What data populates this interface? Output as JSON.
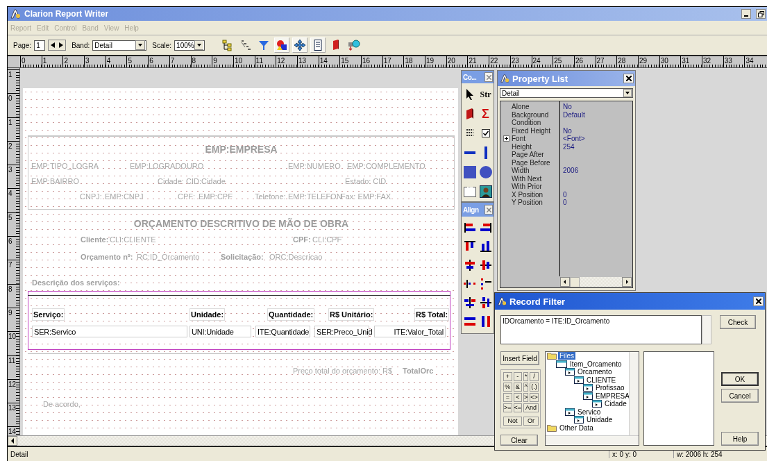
{
  "window": {
    "title": "Clarion Report Writer"
  },
  "menu": [
    {
      "label": "Report",
      "disabled": true
    },
    {
      "label": "Edit",
      "disabled": true
    },
    {
      "label": "Control",
      "disabled": true
    },
    {
      "label": "Band",
      "disabled": true
    },
    {
      "label": "View",
      "disabled": true
    },
    {
      "label": "Help",
      "disabled": true
    }
  ],
  "toolbar": {
    "page_label": "Page:",
    "page": "1",
    "band_label": "Band:",
    "band": "Detail",
    "scale_label": "Scale:",
    "scale": "100%",
    "buttons": [
      {
        "kind": "tree",
        "pressed": false
      },
      {
        "kind": "sort",
        "pressed": false
      },
      {
        "kind": "filter",
        "pressed": false
      },
      {
        "kind": "shapes",
        "pressed": true
      },
      {
        "kind": "move",
        "pressed": true
      },
      {
        "kind": "page",
        "pressed": true
      },
      {
        "kind": "book",
        "pressed": false
      },
      {
        "kind": "globe",
        "pressed": false
      }
    ]
  },
  "ruler": {
    "horizontal": [
      "0",
      "1",
      "2",
      "3",
      "4",
      "5",
      "6",
      "7",
      "8",
      "9",
      "10",
      "11",
      "12",
      "13",
      "14",
      "15",
      "16",
      "17",
      "18",
      "19",
      "20",
      "21",
      "22",
      "23",
      "24",
      "25",
      "26",
      "27",
      "28",
      "29",
      "30",
      "31",
      "32",
      "33",
      "34"
    ],
    "vertical": [
      "1",
      "0",
      "1",
      "2",
      "3",
      "4",
      "5",
      "6",
      "7",
      "8",
      "9",
      "10",
      "11",
      "12",
      "13",
      "14"
    ]
  },
  "report_items": [
    {
      "kind": "heading",
      "text": "EMP:EMPRESA"
    },
    {
      "kind": "text",
      "text": "EMP:TIPO_LOGRA"
    },
    {
      "kind": "text",
      "text": "EMP:LOGRADOURO"
    },
    {
      "kind": "text",
      "text": "EMP:NUMERO"
    },
    {
      "kind": "text",
      "text": "EMP:COMPLEMENTO"
    },
    {
      "kind": "text",
      "text": "EMP:BAIRRO"
    },
    {
      "kind": "text",
      "text": "Cidade: CID:Cidade"
    },
    {
      "kind": "text",
      "text": "Estado: CID"
    },
    {
      "kind": "text",
      "text": "CNPJ:"
    },
    {
      "kind": "text",
      "text": "EMP:CNPJ"
    },
    {
      "kind": "text",
      "text": "CPF:"
    },
    {
      "kind": "text",
      "text": "EMP:CPF"
    },
    {
      "kind": "text",
      "text": "Telefone:"
    },
    {
      "kind": "text",
      "text": "EMP:TELEFON"
    },
    {
      "kind": "text",
      "text": "Fax: EMP:FAX"
    },
    {
      "kind": "heading",
      "text": "ORÇAMENTO DESCRITIVO DE MÃO DE OBRA"
    },
    {
      "kind": "label",
      "text": "Cliente:"
    },
    {
      "kind": "text",
      "text": "CLI:CLIENTE"
    },
    {
      "kind": "label",
      "text": "CPF:"
    },
    {
      "kind": "text",
      "text": "CLI:CPF"
    },
    {
      "kind": "label",
      "text": "Orçamento nº:"
    },
    {
      "kind": "text",
      "text": "RC:ID_Orcamento"
    },
    {
      "kind": "label",
      "text": "Solicitação:"
    },
    {
      "kind": "text",
      "text": "ORC:Descricao"
    },
    {
      "kind": "label",
      "text": "Descrição dos serviços:"
    },
    {
      "kind": "header",
      "text": "Serviço:"
    },
    {
      "kind": "header",
      "text": "Unidade:"
    },
    {
      "kind": "header",
      "text": "Quantidade:"
    },
    {
      "kind": "header",
      "text": "R$ Unitário:"
    },
    {
      "kind": "header",
      "text": "R$ Total:"
    },
    {
      "kind": "data",
      "text": "SER:Servico"
    },
    {
      "kind": "data",
      "text": "UNI:Unidade"
    },
    {
      "kind": "data",
      "text": "ITE:Quantidade"
    },
    {
      "kind": "data",
      "text": "SER:Preco_Unid"
    },
    {
      "kind": "data",
      "text": "ITE:Valor_Total"
    },
    {
      "kind": "text",
      "text": "Preço total do orçamento:  R$"
    },
    {
      "kind": "label",
      "text": "TotalOrc"
    },
    {
      "kind": "text",
      "text": "De acordo,"
    }
  ],
  "status_bar": [
    "Detail",
    "x: 0  y: 0",
    "w: 2006  h: 254"
  ],
  "control_tools": {
    "title": "Co...",
    "tools": [
      {
        "kind": "pointer"
      },
      {
        "kind": "string",
        "label": "Str"
      },
      {
        "kind": "report"
      },
      {
        "kind": "total",
        "label": "Σ"
      },
      {
        "kind": "text"
      },
      {
        "kind": "check"
      },
      {
        "kind": "hline"
      },
      {
        "kind": "vline"
      },
      {
        "kind": "box"
      },
      {
        "kind": "ellipse"
      },
      {
        "kind": "group"
      },
      {
        "kind": "image"
      }
    ]
  },
  "align_tools": {
    "title": "Align",
    "tools": [
      {
        "kind": "left"
      },
      {
        "kind": "right"
      },
      {
        "kind": "top"
      },
      {
        "kind": "bottom"
      },
      {
        "kind": "center-h"
      },
      {
        "kind": "center-v"
      },
      {
        "kind": "spread-h"
      },
      {
        "kind": "spread-v"
      },
      {
        "kind": "page-h"
      },
      {
        "kind": "page-v"
      },
      {
        "kind": "width"
      },
      {
        "kind": "height"
      }
    ]
  },
  "property_list": {
    "title": "Property List",
    "selector": "Detail",
    "properties": [
      {
        "name": "Alone",
        "value": "No",
        "expandable": false
      },
      {
        "name": "Background",
        "value": "Default",
        "expandable": false
      },
      {
        "name": "Condition",
        "expandable": false
      },
      {
        "name": "Fixed Height",
        "value": "No",
        "expandable": false
      },
      {
        "name": "Font",
        "value": "<Font>",
        "expandable": true
      },
      {
        "name": "Height",
        "value": "254",
        "expandable": false
      },
      {
        "name": "Page After",
        "expandable": false
      },
      {
        "name": "Page Before",
        "expandable": false
      },
      {
        "name": "Width",
        "value": "2006",
        "expandable": false
      },
      {
        "name": "With Next",
        "expandable": false
      },
      {
        "name": "With Prior",
        "expandable": false
      },
      {
        "name": "X Position",
        "value": "0",
        "expandable": false
      },
      {
        "name": "Y Position",
        "value": "0",
        "expandable": false
      }
    ]
  },
  "record_filter": {
    "title": "Record Filter",
    "expression": "IDOrcamento =  ITE:ID_Orcamento",
    "check": "Check",
    "insert_field": "Insert Field",
    "operators": [
      "+",
      "-",
      "*",
      "/",
      "%",
      "&",
      "^",
      "(.)",
      "=",
      "<",
      ">",
      "<>",
      ">=",
      "<=",
      "And",
      "Not",
      "Or"
    ],
    "clear": "Clear",
    "ok": "OK",
    "cancel": "Cancel",
    "help": "Help",
    "tree": [
      {
        "label": "Files",
        "kind": "folder",
        "selected": true,
        "children": [
          {
            "label": "Item_Orcamento",
            "kind": "file",
            "selected": false,
            "children": [
              {
                "label": "Orcamento",
                "kind": "table",
                "selected": false,
                "children": [
                  {
                    "label": "CLIENTE",
                    "kind": "table",
                    "selected": false,
                    "children": [
                      {
                        "label": "Profissao",
                        "kind": "table",
                        "selected": false
                      },
                      {
                        "label": "EMPRESA",
                        "kind": "table",
                        "selected": false,
                        "children": [
                          {
                            "label": "Cidade",
                            "kind": "table",
                            "selected": false
                          }
                        ]
                      }
                    ]
                  }
                ]
              },
              {
                "label": "Servico",
                "kind": "table",
                "selected": false,
                "children": [
                  {
                    "label": "Unidade",
                    "kind": "table",
                    "selected": false
                  }
                ]
              }
            ]
          }
        ]
      },
      {
        "label": "Other Data",
        "kind": "folder",
        "selected": false
      }
    ]
  }
}
